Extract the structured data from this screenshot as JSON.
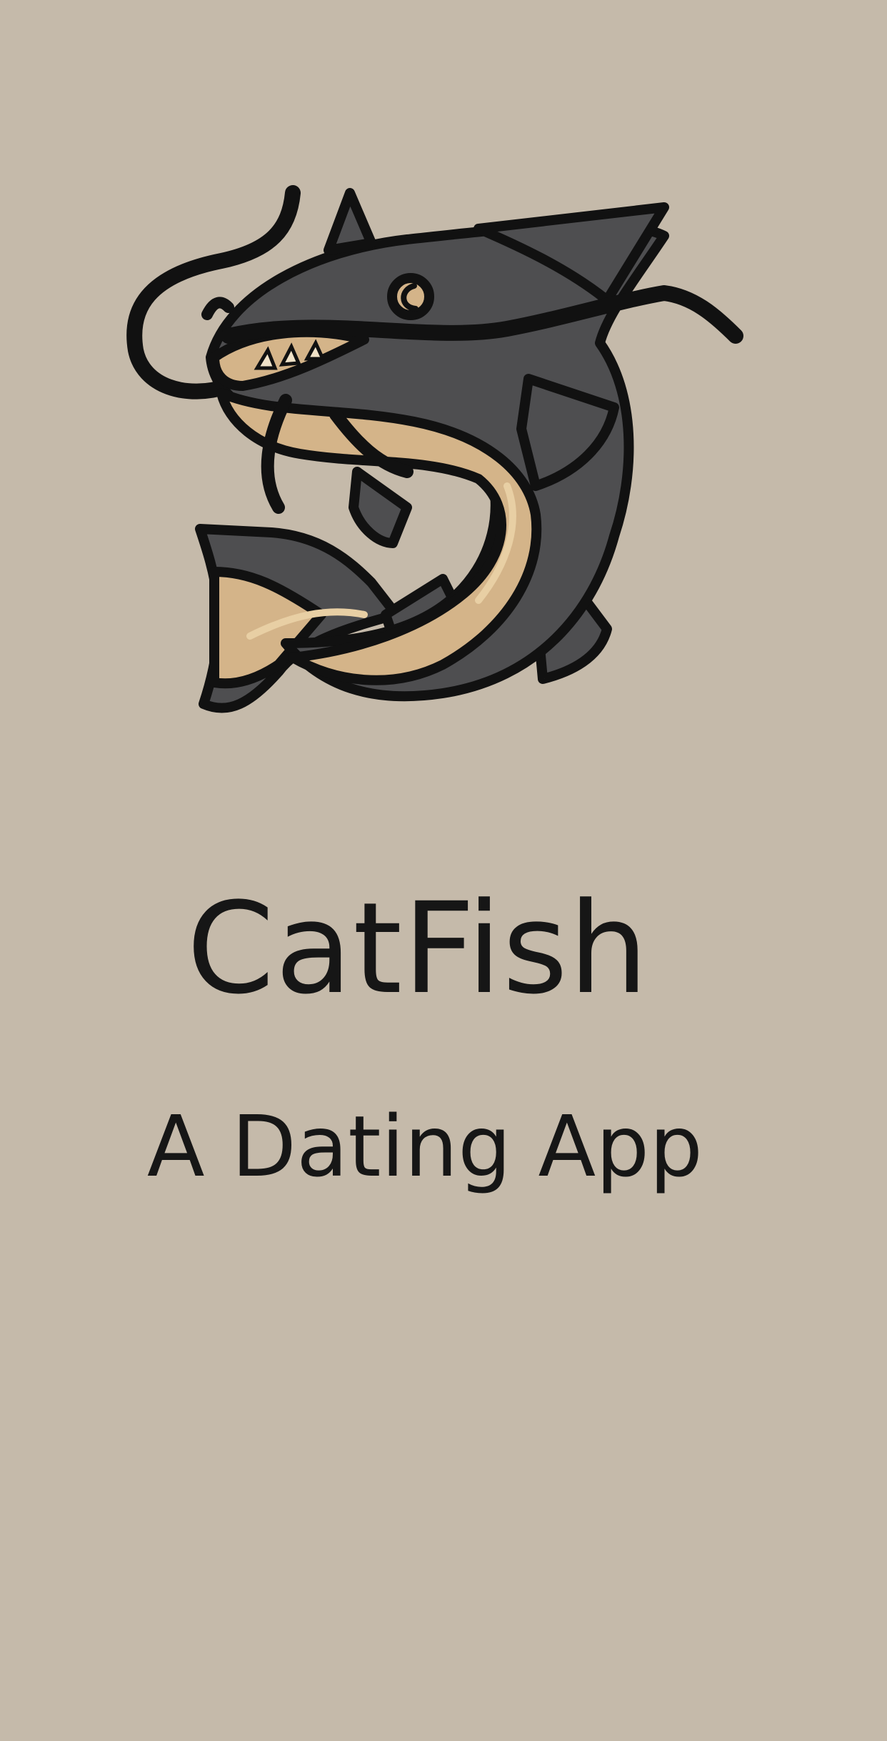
{
  "app": {
    "name": "CatFish",
    "tagline": "A Dating App"
  },
  "logo": {
    "icon": "catfish-icon"
  },
  "colors": {
    "background": "#c5baaa",
    "text": "#161616",
    "fish_dark": "#4e4e50",
    "fish_light": "#d4b489",
    "fish_highlight": "#e8cfa4",
    "outline": "#111111"
  }
}
